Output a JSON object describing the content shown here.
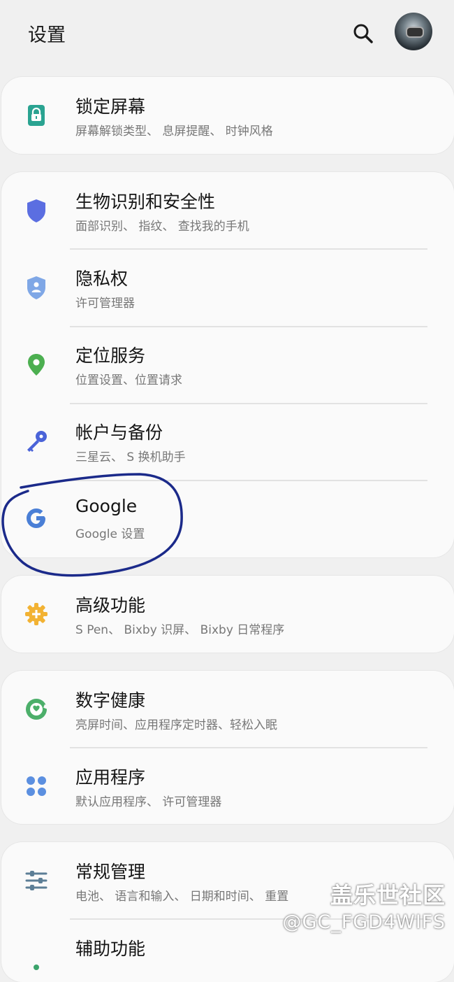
{
  "header": {
    "title": "设置",
    "search_icon": "search-icon",
    "avatar_icon": "avatar"
  },
  "cards": [
    {
      "items": [
        {
          "title": "锁定屏幕",
          "sub": "屏幕解锁类型、 息屏提醒、 时钟风格",
          "icon": "lock-icon",
          "color": "#2aa391"
        }
      ]
    },
    {
      "items": [
        {
          "title": "生物识别和安全性",
          "sub": "面部识别、 指纹、 查找我的手机",
          "icon": "shield-icon",
          "color": "#5b6ee1"
        },
        {
          "title": "隐私权",
          "sub": "许可管理器",
          "icon": "privacy-shield-icon",
          "color": "#7fa7e6"
        },
        {
          "title": "定位服务",
          "sub": "位置设置、位置请求",
          "icon": "location-pin-icon",
          "color": "#4caf50"
        },
        {
          "title": "帐户与备份",
          "sub": "三星云、 S 换机助手",
          "icon": "key-icon",
          "color": "#4a63d8"
        },
        {
          "title": "Google",
          "sub": "Google 设置",
          "icon": "google-icon",
          "color": "#4a7fd6"
        }
      ]
    },
    {
      "items": [
        {
          "title": "高级功能",
          "sub": "S Pen、 Bixby 识屏、 Bixby 日常程序",
          "icon": "advanced-gear-icon",
          "color": "#f2b233"
        }
      ]
    },
    {
      "items": [
        {
          "title": "数字健康",
          "sub": "亮屏时间、应用程序定时器、轻松入眠",
          "icon": "digital-wellbeing-icon",
          "color": "#4caf6a"
        },
        {
          "title": "应用程序",
          "sub": "默认应用程序、 许可管理器",
          "icon": "apps-grid-icon",
          "color": "#5b8fe0"
        }
      ]
    },
    {
      "items": [
        {
          "title": "常规管理",
          "sub": "电池、 语言和输入、 日期和时间、 重置",
          "icon": "sliders-icon",
          "color": "#5c7e96"
        },
        {
          "title": "辅助功能",
          "sub": "",
          "icon": "accessibility-icon",
          "color": "#3aa36b"
        }
      ]
    }
  ],
  "watermark": {
    "line1": "盖乐世社区",
    "line2": "@GC_FGD4WIFS"
  }
}
